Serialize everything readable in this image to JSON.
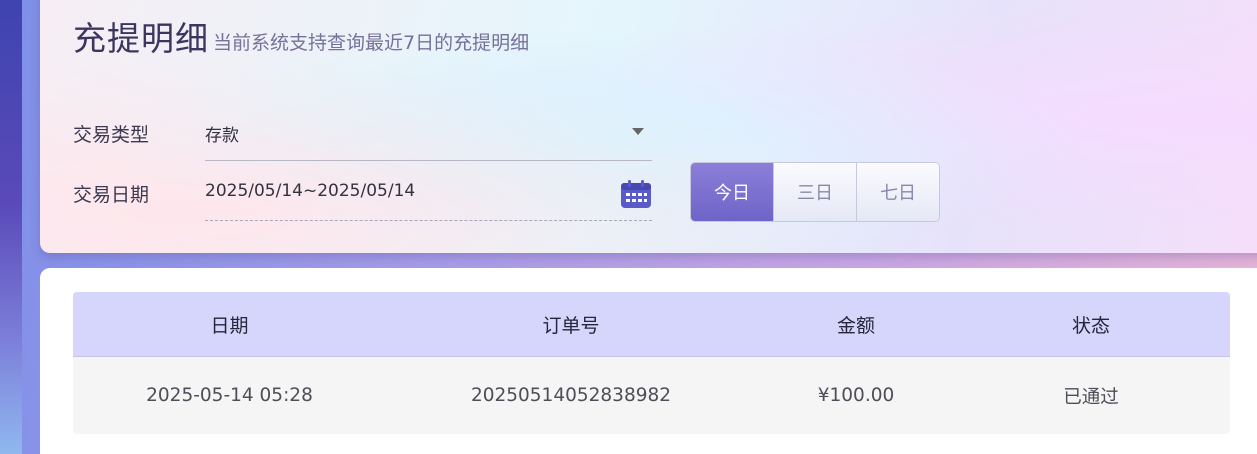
{
  "header": {
    "title": "充提明细",
    "subtitle": "当前系统支持查询最近7日的充提明细"
  },
  "filters": {
    "type_label": "交易类型",
    "type_value": "存款",
    "date_label": "交易日期",
    "date_value": "2025/05/14~2025/05/14"
  },
  "range_buttons": [
    "今日",
    "三日",
    "七日"
  ],
  "active_range": "今日",
  "icons": {
    "calendar": "calendar-icon",
    "dropdown": "chevron-down-icon"
  },
  "colors": {
    "accent": "#7466cc",
    "table_header_bg": "#d6d6fc",
    "calendar_icon": "#5a5ac8"
  },
  "table": {
    "columns": [
      "日期",
      "订单号",
      "金额",
      "状态"
    ],
    "rows": [
      [
        "2025-05-14 05:28",
        "20250514052838982",
        "¥100.00",
        "已通过"
      ]
    ]
  }
}
